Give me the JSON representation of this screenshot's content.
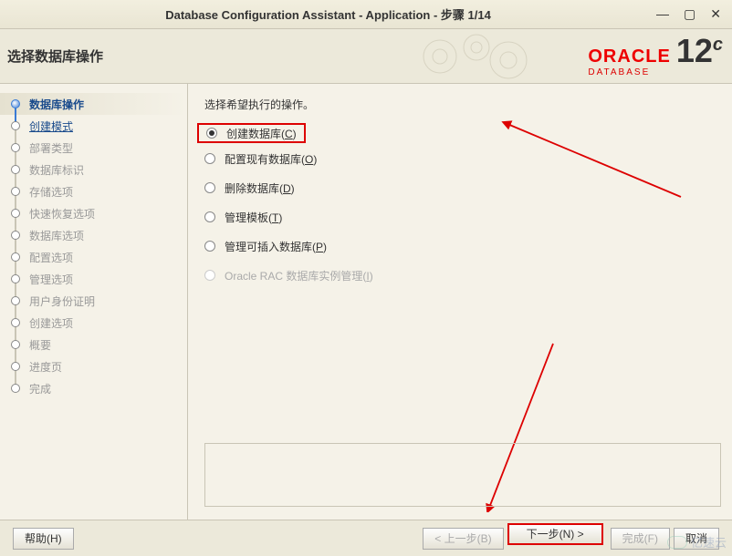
{
  "titlebar": {
    "title": "Database Configuration Assistant - Application - 步骤 1/14"
  },
  "header": {
    "page_title": "选择数据库操作",
    "vendor": "ORACLE",
    "vendor_sub": "DATABASE",
    "version": "12",
    "version_suffix": "c"
  },
  "sidebar": {
    "steps": [
      {
        "label": "数据库操作",
        "state": "current"
      },
      {
        "label": "创建模式",
        "state": "link"
      },
      {
        "label": "部署类型",
        "state": "inactive"
      },
      {
        "label": "数据库标识",
        "state": "inactive"
      },
      {
        "label": "存储选项",
        "state": "inactive"
      },
      {
        "label": "快速恢复选项",
        "state": "inactive"
      },
      {
        "label": "数据库选项",
        "state": "inactive"
      },
      {
        "label": "配置选项",
        "state": "inactive"
      },
      {
        "label": "管理选项",
        "state": "inactive"
      },
      {
        "label": "用户身份证明",
        "state": "inactive"
      },
      {
        "label": "创建选项",
        "state": "inactive"
      },
      {
        "label": "概要",
        "state": "inactive"
      },
      {
        "label": "进度页",
        "state": "inactive"
      },
      {
        "label": "完成",
        "state": "inactive"
      }
    ]
  },
  "main": {
    "instruction": "选择希望执行的操作。",
    "options": [
      {
        "label": "创建数据库",
        "accel": "C",
        "selected": true,
        "enabled": true
      },
      {
        "label": "配置现有数据库",
        "accel": "O",
        "selected": false,
        "enabled": true
      },
      {
        "label": "删除数据库",
        "accel": "D",
        "selected": false,
        "enabled": true
      },
      {
        "label": "管理模板",
        "accel": "T",
        "selected": false,
        "enabled": true
      },
      {
        "label": "管理可插入数据库",
        "accel": "P",
        "selected": false,
        "enabled": true
      },
      {
        "label": "Oracle RAC 数据库实例管理",
        "accel": "I",
        "selected": false,
        "enabled": false
      }
    ]
  },
  "footer": {
    "help": "帮助(H)",
    "back": "< 上一步(B)",
    "next": "下一步(N) >",
    "finish": "完成(F)",
    "cancel": "取消"
  },
  "watermark": "亿速云"
}
